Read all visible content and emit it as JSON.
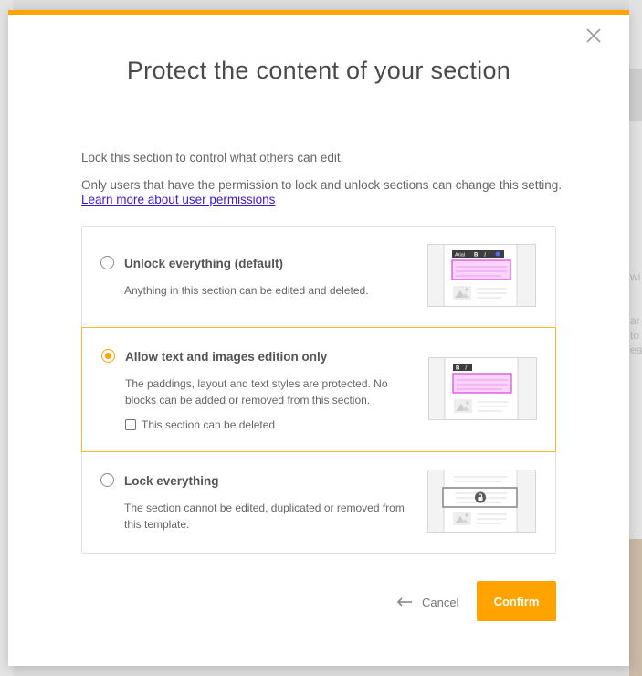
{
  "background": {
    "right_fragments": [
      "wi",
      "ar",
      "to",
      "ea"
    ]
  },
  "modal": {
    "accent_color": "#ffa300",
    "close_icon": "close-icon",
    "title": "Protect the content of your section",
    "description": "Lock this section to control what others can edit.",
    "permission_text": "Only users that have the permission to lock and unlock sections can change this setting.",
    "permission_link": "Learn more about user permissions",
    "options": [
      {
        "title": "Unlock everything (default)",
        "description": "Anything in this section can be edited and deleted.",
        "selected": false,
        "thumbnail": "unlocked-template-thumbnail",
        "toolbar_font": "Arial",
        "toolbar_bold": "B",
        "toolbar_italic": "I"
      },
      {
        "title": "Allow text and images edition only",
        "description": "The paddings, layout and text styles are protected. No blocks can be added or removed from this section.",
        "selected": true,
        "checkbox_label": "This section can be deleted",
        "checkbox_checked": false,
        "thumbnail": "text-images-template-thumbnail",
        "toolbar_bold": "B",
        "toolbar_italic": "I"
      },
      {
        "title": "Lock everything",
        "description": "The section cannot be edited, duplicated or removed from this template.",
        "selected": false,
        "thumbnail": "locked-template-thumbnail"
      }
    ],
    "cancel_label": "Cancel",
    "confirm_label": "Confirm"
  }
}
